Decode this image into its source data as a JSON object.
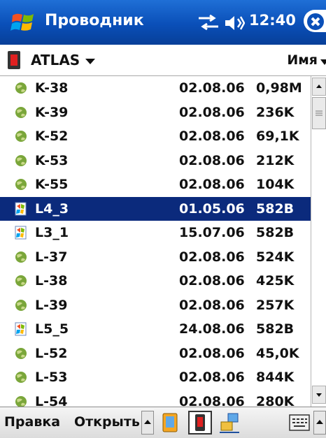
{
  "titlebar": {
    "app_title": "Проводник",
    "clock": "12:40",
    "start_icon": "windows-flag-icon",
    "connectivity_icon": "connectivity-arrows-icon",
    "volume_icon": "speaker-icon",
    "close_icon": "close-icon"
  },
  "folderbar": {
    "folder_name": "ATLAS",
    "sort_label": "Имя"
  },
  "files": [
    {
      "name": "K-38",
      "date": "02.08.06",
      "size": "0,98M",
      "icon": "map-file-icon",
      "selected": false
    },
    {
      "name": "K-39",
      "date": "02.08.06",
      "size": "236K",
      "icon": "map-file-icon",
      "selected": false
    },
    {
      "name": "K-52",
      "date": "02.08.06",
      "size": "69,1K",
      "icon": "map-file-icon",
      "selected": false
    },
    {
      "name": "K-53",
      "date": "02.08.06",
      "size": "212K",
      "icon": "map-file-icon",
      "selected": false
    },
    {
      "name": "K-55",
      "date": "02.08.06",
      "size": "104K",
      "icon": "map-file-icon",
      "selected": false
    },
    {
      "name": "L4_3",
      "date": "01.05.06",
      "size": "582B",
      "icon": "shortcut-file-icon",
      "selected": true
    },
    {
      "name": "L3_1",
      "date": "15.07.06",
      "size": "582B",
      "icon": "shortcut-file-icon",
      "selected": false
    },
    {
      "name": "L-37",
      "date": "02.08.06",
      "size": "524K",
      "icon": "map-file-icon",
      "selected": false
    },
    {
      "name": "L-38",
      "date": "02.08.06",
      "size": "425K",
      "icon": "map-file-icon",
      "selected": false
    },
    {
      "name": "L-39",
      "date": "02.08.06",
      "size": "257K",
      "icon": "map-file-icon",
      "selected": false
    },
    {
      "name": "L5_5",
      "date": "24.08.06",
      "size": "582B",
      "icon": "shortcut-file-icon",
      "selected": false
    },
    {
      "name": "L-52",
      "date": "02.08.06",
      "size": "45,0K",
      "icon": "map-file-icon",
      "selected": false
    },
    {
      "name": "L-53",
      "date": "02.08.06",
      "size": "844K",
      "icon": "map-file-icon",
      "selected": false
    },
    {
      "name": "L-54",
      "date": "02.08.06",
      "size": "280K",
      "icon": "map-file-icon",
      "selected": false
    }
  ],
  "menubar": {
    "edit_label": "Правка",
    "open_label": "Открыть"
  },
  "colors": {
    "titlebar_blue": "#0a4fb8",
    "selection": "#0b2a7c"
  }
}
